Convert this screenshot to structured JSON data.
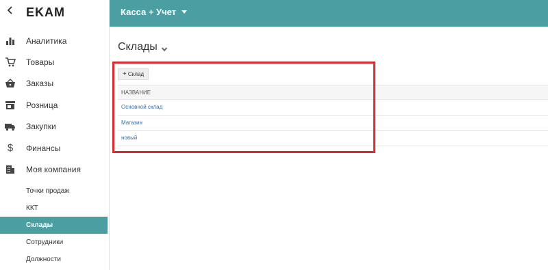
{
  "sidebar": {
    "logo": "EKAM",
    "nav": [
      {
        "label": "Аналитика",
        "icon": "bar-chart-icon"
      },
      {
        "label": "Товары",
        "icon": "cart-icon"
      },
      {
        "label": "Заказы",
        "icon": "basket-icon"
      },
      {
        "label": "Розница",
        "icon": "store-icon"
      },
      {
        "label": "Закупки",
        "icon": "truck-icon"
      },
      {
        "label": "Финансы",
        "icon": "dollar-icon"
      },
      {
        "label": "Моя компания",
        "icon": "building-icon"
      }
    ],
    "sub": [
      {
        "label": "Точки продаж",
        "active": false
      },
      {
        "label": "ККТ",
        "active": false
      },
      {
        "label": "Склады",
        "active": true
      },
      {
        "label": "Сотрудники",
        "active": false
      },
      {
        "label": "Должности",
        "active": false
      }
    ]
  },
  "topbar": {
    "app_name": "Касса + Учет"
  },
  "main": {
    "title": "Склады",
    "add_button": "Склад",
    "table": {
      "header": "НАЗВАНИЕ",
      "rows": [
        "Основной склад",
        "Магазин",
        "новый"
      ]
    }
  },
  "colors": {
    "accent": "#4b9ea1",
    "highlight": "#d62a2f",
    "link": "#3a6ea5"
  }
}
